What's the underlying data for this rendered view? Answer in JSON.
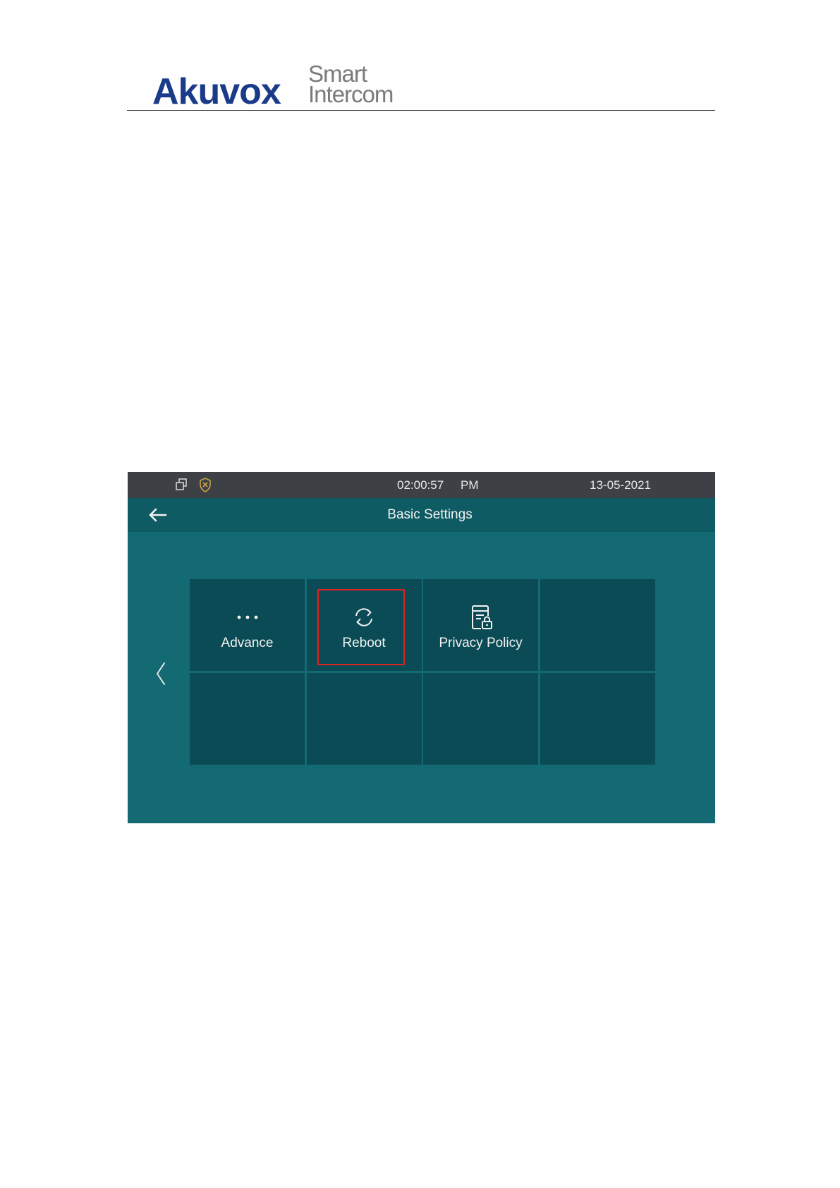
{
  "document_header": {
    "brand_name": "Akuvox",
    "tagline_line1": "Smart",
    "tagline_line2": "Intercom",
    "brand_color": "#1a3a8a",
    "tagline_color": "#7a7a7a"
  },
  "device": {
    "status_bar": {
      "icons": [
        "overlap-windows-icon",
        "shield-x-icon"
      ],
      "time": "02:00:57",
      "ampm": "PM",
      "date": "13-05-2021"
    },
    "title_bar": {
      "back_icon": "arrow-left-icon",
      "title": "Basic Settings"
    },
    "navigation": {
      "prev_icon": "chevron-left-icon"
    },
    "tiles": [
      {
        "label": "Advance",
        "icon": "more-dots-icon",
        "highlighted": false
      },
      {
        "label": "Reboot",
        "icon": "reboot-icon",
        "highlighted": true
      },
      {
        "label": "Privacy Policy",
        "icon": "privacy-policy-icon",
        "highlighted": false
      },
      {
        "label": "",
        "icon": "",
        "highlighted": false
      },
      {
        "label": "",
        "icon": "",
        "highlighted": false
      },
      {
        "label": "",
        "icon": "",
        "highlighted": false
      },
      {
        "label": "",
        "icon": "",
        "highlighted": false
      },
      {
        "label": "",
        "icon": "",
        "highlighted": false
      }
    ],
    "colors": {
      "screen_background": "#136a73",
      "status_bar": "#3d4145",
      "title_bar": "#0f5b64",
      "tile": "#0a4b55",
      "highlight_border": "#e02323",
      "shield_icon": "#c9a24a"
    }
  }
}
